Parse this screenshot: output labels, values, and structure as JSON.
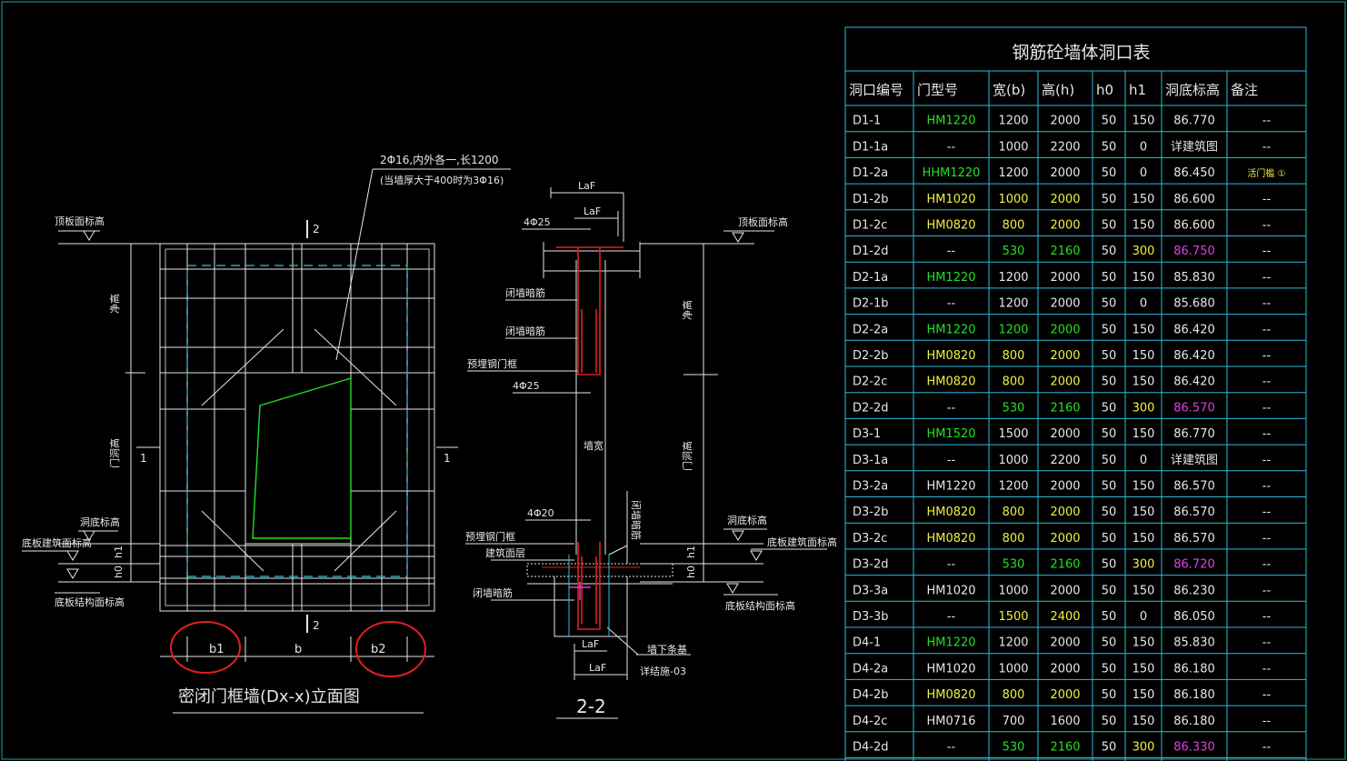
{
  "colors": {
    "bg": "#000000",
    "frame": "#1fa6a6",
    "white": "#e6e6e6",
    "green": "#22e022",
    "yellow": "#f0f040",
    "magenta": "#e040e0",
    "red": "#e02020",
    "cyan": "#30c0e0",
    "table_line": "#30b8d8"
  },
  "elevation": {
    "note_line1": "2Φ16,内外各一,长1200",
    "note_line2": "(当墙厚大于400时为3Φ16)",
    "top_label": "顶板面标高",
    "sill_label": "洞底标高",
    "floor_arch_label": "底板建筑面标高",
    "floor_struct_label": "底板结构面标高",
    "dim_net_height": "净高",
    "dim_door_height": "门洞高",
    "dim_h1": "h1",
    "dim_h0": "h0",
    "section_mark": "2",
    "side_mark": "1",
    "dim_b1": "b1",
    "dim_b": "b",
    "dim_b2": "b2",
    "title": "密闭门框墙(Dx-x)立面图"
  },
  "section": {
    "laf_top_outer": "LaF",
    "laf_top_inner": "LaF",
    "rebar_top": "4Φ25",
    "rebar_mid": "4Φ25",
    "rebar_low": "4Φ20",
    "label_dark1": "闭墙暗筋",
    "label_dark2": "闭墙暗筋",
    "label_frame": "预埋钢门框",
    "label_frame2": "预埋钢门框",
    "label_wall": "墙宽",
    "label_floor": "建筑面层",
    "label_dark3": "闭墙暗筋",
    "label_vertical": "闭墙暗筋",
    "laf_bottom_inner": "LaF",
    "laf_bottom_outer": "LaF",
    "label_beam": "墙下条基",
    "label_detail": "详结施-03",
    "title": "2-2",
    "right_top": "顶板面标高",
    "right_net": "净高",
    "right_door": "门洞高",
    "right_sill": "洞底标高",
    "right_floor_arch": "底板建筑面标高",
    "right_floor_struct": "底板结构面标高",
    "right_h1": "h1",
    "right_h0": "h0"
  },
  "table": {
    "title": "钢筋砼墙体洞口表",
    "headers": [
      "洞口编号",
      "门型号",
      "宽(b)",
      "高(h)",
      "h0",
      "h1",
      "洞底标高",
      "备注"
    ],
    "rows": [
      {
        "id": "D1-1",
        "type": "HM1220",
        "w": "1200",
        "h": "2000",
        "h0": "50",
        "h1": "150",
        "elev": "86.770",
        "note": "--",
        "tc": "green",
        "wc": "white",
        "ec": "white",
        "nc": "white"
      },
      {
        "id": "D1-1a",
        "type": "--",
        "w": "1000",
        "h": "2200",
        "h0": "50",
        "h1": "0",
        "elev": "详建筑图",
        "note": "--",
        "tc": "white",
        "wc": "white",
        "ec": "white",
        "nc": "white"
      },
      {
        "id": "D1-2a",
        "type": "HHM1220",
        "w": "1200",
        "h": "2000",
        "h0": "50",
        "h1": "0",
        "elev": "86.450",
        "note": "活门槛 ①",
        "tc": "green",
        "wc": "white",
        "ec": "white",
        "nc": "yellow"
      },
      {
        "id": "D1-2b",
        "type": "HM1020",
        "w": "1000",
        "h": "2000",
        "h0": "50",
        "h1": "150",
        "elev": "86.600",
        "note": "--",
        "tc": "yellow",
        "wc": "yellow",
        "ec": "white",
        "nc": "white"
      },
      {
        "id": "D1-2c",
        "type": "HM0820",
        "w": "800",
        "h": "2000",
        "h0": "50",
        "h1": "150",
        "elev": "86.600",
        "note": "--",
        "tc": "yellow",
        "wc": "yellow",
        "ec": "white",
        "nc": "white"
      },
      {
        "id": "D1-2d",
        "type": "--",
        "w": "530",
        "h": "2160",
        "h0": "50",
        "h1": "300",
        "elev": "86.750",
        "note": "--",
        "tc": "white",
        "wc": "green",
        "ec": "magenta",
        "nc": "white"
      },
      {
        "id": "D2-1a",
        "type": "HM1220",
        "w": "1200",
        "h": "2000",
        "h0": "50",
        "h1": "150",
        "elev": "85.830",
        "note": "--",
        "tc": "green",
        "wc": "white",
        "ec": "white",
        "nc": "white"
      },
      {
        "id": "D2-1b",
        "type": "--",
        "w": "1200",
        "h": "2000",
        "h0": "50",
        "h1": "0",
        "elev": "85.680",
        "note": "--",
        "tc": "white",
        "wc": "white",
        "ec": "white",
        "nc": "white"
      },
      {
        "id": "D2-2a",
        "type": "HM1220",
        "w": "1200",
        "h": "2000",
        "h0": "50",
        "h1": "150",
        "elev": "86.420",
        "note": "--",
        "tc": "green",
        "wc": "green",
        "ec": "white",
        "nc": "white"
      },
      {
        "id": "D2-2b",
        "type": "HM0820",
        "w": "800",
        "h": "2000",
        "h0": "50",
        "h1": "150",
        "elev": "86.420",
        "note": "--",
        "tc": "yellow",
        "wc": "yellow",
        "ec": "white",
        "nc": "white"
      },
      {
        "id": "D2-2c",
        "type": "HM0820",
        "w": "800",
        "h": "2000",
        "h0": "50",
        "h1": "150",
        "elev": "86.420",
        "note": "--",
        "tc": "yellow",
        "wc": "yellow",
        "ec": "white",
        "nc": "white"
      },
      {
        "id": "D2-2d",
        "type": "--",
        "w": "530",
        "h": "2160",
        "h0": "50",
        "h1": "300",
        "elev": "86.570",
        "note": "--",
        "tc": "white",
        "wc": "green",
        "ec": "magenta",
        "nc": "white"
      },
      {
        "id": "D3-1",
        "type": "HM1520",
        "w": "1500",
        "h": "2000",
        "h0": "50",
        "h1": "150",
        "elev": "86.770",
        "note": "--",
        "tc": "green",
        "wc": "white",
        "ec": "white",
        "nc": "white"
      },
      {
        "id": "D3-1a",
        "type": "--",
        "w": "1000",
        "h": "2200",
        "h0": "50",
        "h1": "0",
        "elev": "详建筑图",
        "note": "--",
        "tc": "white",
        "wc": "white",
        "ec": "white",
        "nc": "white"
      },
      {
        "id": "D3-2a",
        "type": "HM1220",
        "w": "1200",
        "h": "2000",
        "h0": "50",
        "h1": "150",
        "elev": "86.570",
        "note": "--",
        "tc": "white",
        "wc": "white",
        "ec": "white",
        "nc": "white"
      },
      {
        "id": "D3-2b",
        "type": "HM0820",
        "w": "800",
        "h": "2000",
        "h0": "50",
        "h1": "150",
        "elev": "86.570",
        "note": "--",
        "tc": "yellow",
        "wc": "yellow",
        "ec": "white",
        "nc": "white"
      },
      {
        "id": "D3-2c",
        "type": "HM0820",
        "w": "800",
        "h": "2000",
        "h0": "50",
        "h1": "150",
        "elev": "86.570",
        "note": "--",
        "tc": "yellow",
        "wc": "yellow",
        "ec": "white",
        "nc": "white"
      },
      {
        "id": "D3-2d",
        "type": "--",
        "w": "530",
        "h": "2160",
        "h0": "50",
        "h1": "300",
        "elev": "86.720",
        "note": "--",
        "tc": "white",
        "wc": "green",
        "ec": "magenta",
        "nc": "white"
      },
      {
        "id": "D3-3a",
        "type": "HM1020",
        "w": "1000",
        "h": "2000",
        "h0": "50",
        "h1": "150",
        "elev": "86.230",
        "note": "--",
        "tc": "white",
        "wc": "white",
        "ec": "white",
        "nc": "white"
      },
      {
        "id": "D3-3b",
        "type": "--",
        "w": "1500",
        "h": "2400",
        "h0": "50",
        "h1": "0",
        "elev": "86.050",
        "note": "--",
        "tc": "white",
        "wc": "yellow",
        "ec": "white",
        "nc": "white"
      },
      {
        "id": "D4-1",
        "type": "HM1220",
        "w": "1200",
        "h": "2000",
        "h0": "50",
        "h1": "150",
        "elev": "85.830",
        "note": "--",
        "tc": "green",
        "wc": "white",
        "ec": "white",
        "nc": "white"
      },
      {
        "id": "D4-2a",
        "type": "HM1020",
        "w": "1000",
        "h": "2000",
        "h0": "50",
        "h1": "150",
        "elev": "86.180",
        "note": "--",
        "tc": "white",
        "wc": "white",
        "ec": "white",
        "nc": "white"
      },
      {
        "id": "D4-2b",
        "type": "HM0820",
        "w": "800",
        "h": "2000",
        "h0": "50",
        "h1": "150",
        "elev": "86.180",
        "note": "--",
        "tc": "yellow",
        "wc": "yellow",
        "ec": "white",
        "nc": "white"
      },
      {
        "id": "D4-2c",
        "type": "HM0716",
        "w": "700",
        "h": "1600",
        "h0": "50",
        "h1": "150",
        "elev": "86.180",
        "note": "--",
        "tc": "white",
        "wc": "white",
        "ec": "white",
        "nc": "white"
      },
      {
        "id": "D4-2d",
        "type": "--",
        "w": "530",
        "h": "2160",
        "h0": "50",
        "h1": "300",
        "elev": "86.330",
        "note": "--",
        "tc": "white",
        "wc": "green",
        "ec": "magenta",
        "nc": "white"
      }
    ]
  }
}
